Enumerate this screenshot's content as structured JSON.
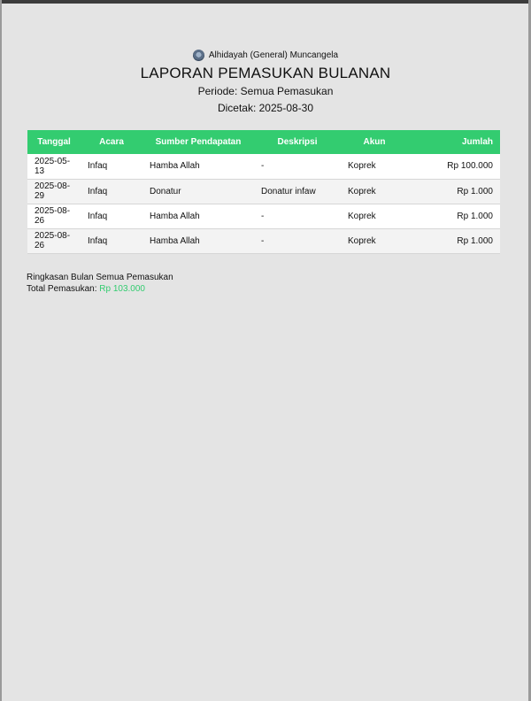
{
  "header": {
    "organization": "Alhidayah (General) Muncangela",
    "title": "LAPORAN PEMASUKAN BULANAN",
    "period": "Periode: Semua Pemasukan",
    "printed": "Dicetak: 2025-08-30"
  },
  "table": {
    "columns": [
      "Tanggal",
      "Acara",
      "Sumber Pendapatan",
      "Deskripsi",
      "Akun",
      "Jumlah"
    ],
    "rows": [
      [
        "2025-05-13",
        "Infaq",
        "Hamba Allah",
        "-",
        "Koprek",
        "Rp 100.000"
      ],
      [
        "2025-08-29",
        "Infaq",
        "Donatur",
        "Donatur infaw",
        "Koprek",
        "Rp 1.000"
      ],
      [
        "2025-08-26",
        "Infaq",
        "Hamba Allah",
        "-",
        "Koprek",
        "Rp 1.000"
      ],
      [
        "2025-08-26",
        "Infaq",
        "Hamba Allah",
        "-",
        "Koprek",
        "Rp 1.000"
      ]
    ]
  },
  "summary": {
    "heading": "Ringkasan Bulan Semua Pemasukan",
    "total_label": "Total Pemasukan:",
    "total_value": "Rp 103.000"
  },
  "colors": {
    "accent": "#33cc70",
    "background": "#e4e4e4"
  }
}
